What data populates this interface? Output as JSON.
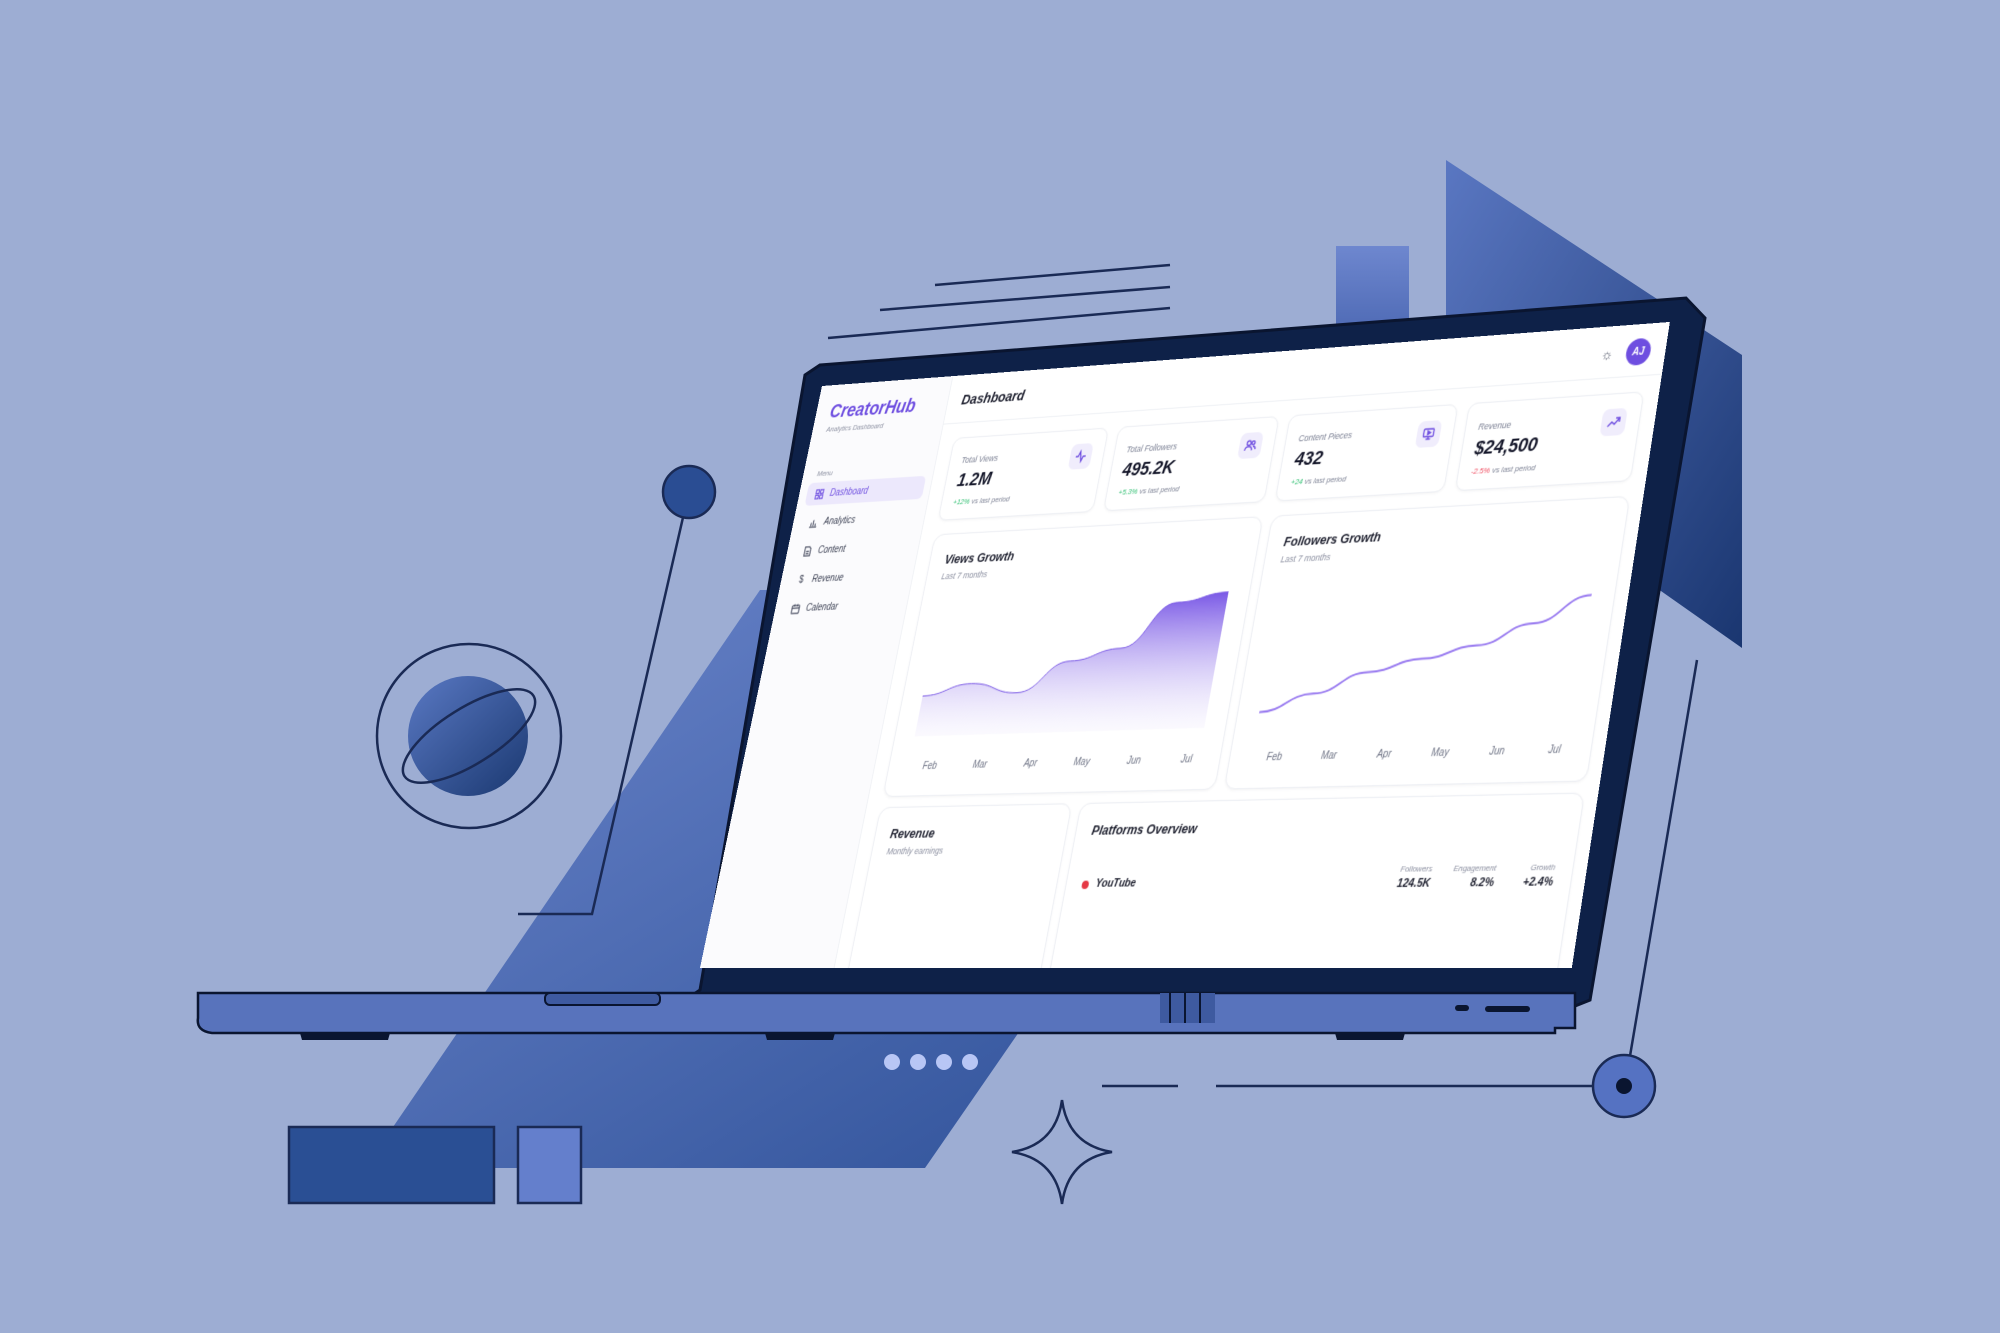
{
  "app": {
    "name": "CreatorHub",
    "subtitle": "Analytics Dashboard"
  },
  "sidebar": {
    "menu_title": "Menu",
    "items": [
      {
        "label": "Dashboard",
        "icon": "grid-icon",
        "active": true
      },
      {
        "label": "Analytics",
        "icon": "bar-chart-icon",
        "active": false
      },
      {
        "label": "Content",
        "icon": "document-icon",
        "active": false
      },
      {
        "label": "Revenue",
        "icon": "dollar-icon",
        "active": false
      },
      {
        "label": "Calendar",
        "icon": "calendar-icon",
        "active": false
      }
    ]
  },
  "header": {
    "title": "Dashboard",
    "avatar_initials": "AJ",
    "theme_icon": "sun-icon"
  },
  "stats": [
    {
      "label": "Total Views",
      "value": "1.2M",
      "delta": "+12%",
      "delta_suffix": "vs last period",
      "trend": "up",
      "icon": "activity-icon"
    },
    {
      "label": "Total Followers",
      "value": "495.2K",
      "delta": "+5.3%",
      "delta_suffix": "vs last period",
      "trend": "up",
      "icon": "users-icon"
    },
    {
      "label": "Content Pieces",
      "value": "432",
      "delta": "+24",
      "delta_suffix": "vs last period",
      "trend": "up",
      "icon": "monitor-icon"
    },
    {
      "label": "Revenue",
      "value": "$24,500",
      "delta": "-2.5%",
      "delta_suffix": "vs last period",
      "trend": "down",
      "icon": "trending-up-icon"
    }
  ],
  "views_chart": {
    "title": "Views Growth",
    "subtitle": "Last 7 months",
    "months": [
      "Feb",
      "Mar",
      "Apr",
      "May",
      "Jun",
      "Jul"
    ],
    "values": [
      0.3,
      0.38,
      0.3,
      0.52,
      0.6,
      0.92,
      0.98
    ]
  },
  "followers_chart": {
    "title": "Followers Growth",
    "subtitle": "Last 7 months",
    "months": [
      "Feb",
      "Mar",
      "Apr",
      "May",
      "Jun",
      "Jul"
    ],
    "values": [
      0.1,
      0.22,
      0.36,
      0.44,
      0.52,
      0.66,
      0.84
    ]
  },
  "revenue_card": {
    "title": "Revenue",
    "subtitle": "Monthly earnings"
  },
  "platforms": {
    "title": "Platforms Overview",
    "headers": {
      "followers": "Followers",
      "engagement": "Engagement",
      "growth": "Growth"
    },
    "rows": [
      {
        "name": "YouTube",
        "color": "#e53945",
        "followers": "124.5K",
        "engagement": "8.2%",
        "growth": "+2.4%"
      }
    ]
  },
  "colors": {
    "accent": "#6e4ee0",
    "background": "#9dadd3",
    "navy": "#1f3b7a"
  }
}
